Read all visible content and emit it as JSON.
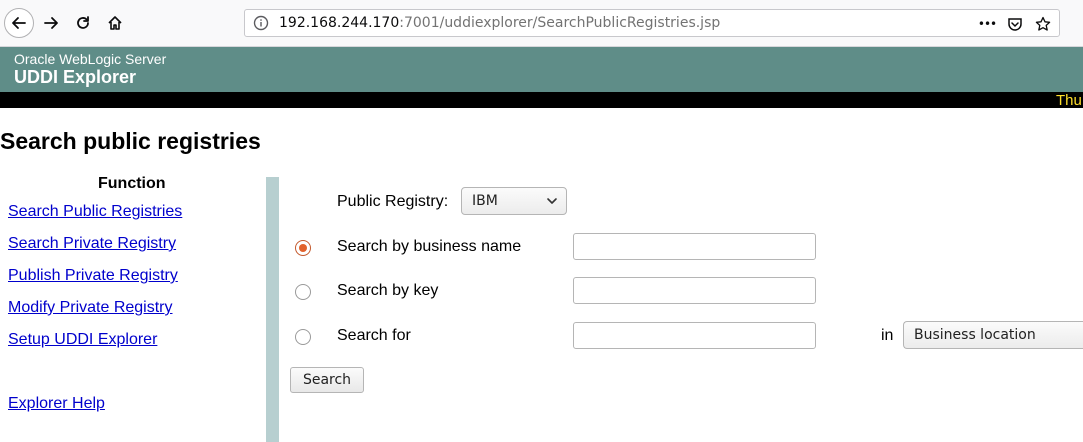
{
  "browser": {
    "url_host": "192.168.244.170",
    "url_rest": ":7001/uddiexplorer/SearchPublicRegistries.jsp",
    "more_glyph": "•••"
  },
  "banner": {
    "subtitle": "Oracle WebLogic Server",
    "title": "UDDI Explorer",
    "ticker": "Thu"
  },
  "page": {
    "title": "Search public registries"
  },
  "sidebar": {
    "heading": "Function",
    "links": [
      "Search Public Registries",
      "Search Private Registry",
      "Publish Private Registry",
      "Modify Private Registry",
      "Setup UDDI Explorer"
    ],
    "help": "Explorer Help"
  },
  "form": {
    "registry_label": "Public Registry:",
    "registry_value": "IBM",
    "by_name_label": "Search by business name",
    "by_key_label": "Search by key",
    "search_for_label": "Search for",
    "in_label": "in",
    "in_value": "Business location",
    "search_button": "Search",
    "selected_option": "business name"
  },
  "colors": {
    "banner": "#5f8d88",
    "link": "#0000cc",
    "ticker": "#ffdf2b",
    "divider": "#b7cfd0"
  }
}
